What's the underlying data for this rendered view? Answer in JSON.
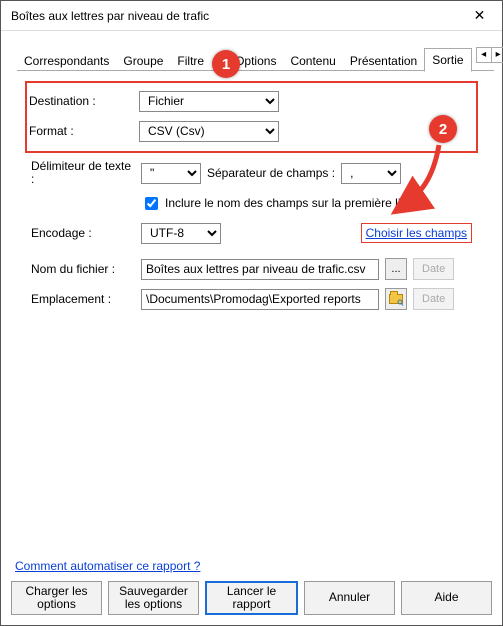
{
  "window": {
    "title": "Boîtes aux lettres par niveau de trafic"
  },
  "tabs": {
    "items": [
      "Correspondants",
      "Groupe",
      "Filtre",
      "Options",
      "Contenu",
      "Présentation",
      "Sortie"
    ],
    "active_index": 6
  },
  "callouts": {
    "one": "1",
    "two": "2"
  },
  "form": {
    "destination": {
      "label": "Destination :",
      "value": "Fichier"
    },
    "format": {
      "label": "Format :",
      "value": "CSV (Csv)"
    },
    "delimiter": {
      "label": "Délimiteur de texte :",
      "value": "\"",
      "separator_label": "Séparateur de champs :",
      "separator_value": ","
    },
    "include_header": {
      "checked": true,
      "label": "Inclure le nom des champs sur la première ligne."
    },
    "encoding": {
      "label": "Encodage :",
      "value": "UTF-8"
    },
    "choose_fields": "Choisir les champs",
    "filename": {
      "label": "Nom du fichier :",
      "value": "Boîtes aux lettres par niveau de trafic.csv",
      "browse": "...",
      "date": "Date"
    },
    "location": {
      "label": "Emplacement :",
      "value": "\\Documents\\Promodag\\Exported reports",
      "date": "Date"
    }
  },
  "automate_link": "Comment automatiser ce rapport ?",
  "buttons": {
    "load": "Charger les options",
    "save": "Sauvegarder les options",
    "run": "Lancer  le rapport",
    "cancel": "Annuler",
    "help": "Aide"
  }
}
